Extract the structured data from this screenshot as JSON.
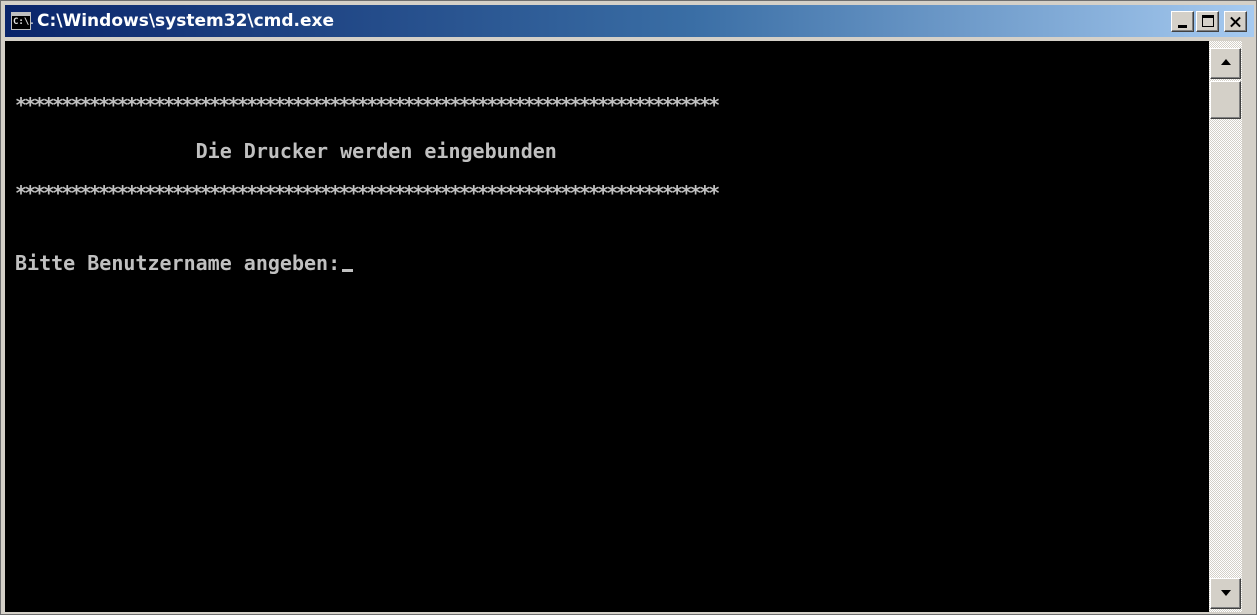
{
  "window": {
    "title": "C:\\Windows\\system32\\cmd.exe",
    "icon_text": "C:\\."
  },
  "console": {
    "lines": [
      "****************************************************************************",
      "               Die Drucker werden eingebunden",
      "****************************************************************************",
      "Bitte Benutzername angeben:"
    ]
  },
  "icons": {
    "app": "cmd-icon",
    "minimize": "minimize-icon",
    "maximize": "maximize-icon",
    "close": "close-icon",
    "scroll_up": "arrow-up-icon",
    "scroll_down": "arrow-down-icon"
  },
  "colors": {
    "console_bg": "#000000",
    "console_fg": "#c0c0c0",
    "titlebar_start": "#0a246a",
    "titlebar_end": "#a6caf0"
  }
}
